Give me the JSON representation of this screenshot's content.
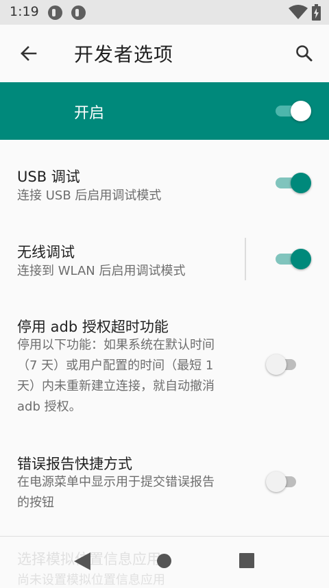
{
  "status": {
    "time": "1:19"
  },
  "appbar": {
    "title": "开发者选项"
  },
  "master": {
    "label": "开启",
    "enabled": true
  },
  "prefs": [
    {
      "title": "USB 调试",
      "summary": "连接 USB 后启用调试模式",
      "enabled": true
    },
    {
      "title": "无线调试",
      "summary": "连接到 WLAN 后启用调试模式",
      "enabled": true
    },
    {
      "title": "停用 adb 授权超时功能",
      "summary_lines": [
        "停用以下功能：如果系统在默认时间",
        "（7 天）或用户配置的时间（最短 1",
        "天）内未重新建立连接，就自动撤消",
        "adb 授权。"
      ],
      "enabled": false
    },
    {
      "title": "错误报告快捷方式",
      "summary_lines": [
        "在电源菜单中显示用于提交错误报告",
        "的按钮"
      ],
      "enabled": false
    }
  ],
  "faded": {
    "title": "选择模拟位置信息应用",
    "summary": "尚未设置模拟位置信息应用"
  },
  "colors": {
    "accent": "#00897b",
    "accent_track": "#80c4bd"
  }
}
